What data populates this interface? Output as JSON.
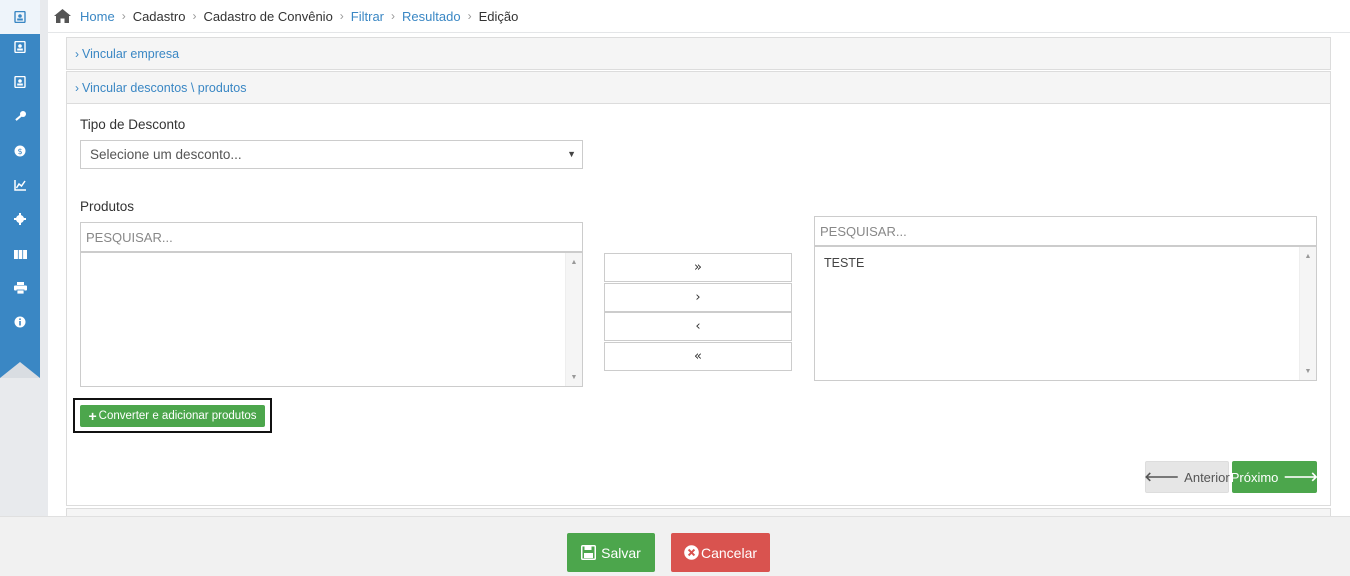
{
  "breadcrumb": {
    "items": [
      {
        "label": "Home",
        "link": true
      },
      {
        "label": "Cadastro",
        "link": false
      },
      {
        "label": "Cadastro de Convênio",
        "link": false
      },
      {
        "label": "Filtrar",
        "link": true
      },
      {
        "label": "Resultado",
        "link": true
      },
      {
        "label": "Edição",
        "link": false
      }
    ]
  },
  "sidebar": {
    "icons": [
      "contact-icon",
      "contact-icon",
      "contact-icon",
      "key-icon",
      "dollar-icon",
      "chart-icon",
      "gear-icon",
      "grid-icon",
      "print-icon",
      "info-icon"
    ]
  },
  "panels": {
    "vincular_empresa": "Vincular empresa",
    "vincular_descontos": "Vincular descontos \\ produtos"
  },
  "form": {
    "tipo_desconto_label": "Tipo de Desconto",
    "tipo_desconto_selected": "Selecione um desconto...",
    "produtos_label": "Produtos",
    "left_search_placeholder": "PESQUISAR...",
    "right_search_placeholder": "PESQUISAR...",
    "right_list_items": [
      "TESTE"
    ],
    "move_all_right": "»",
    "move_right": "›",
    "move_left": "‹",
    "move_all_left": "«",
    "convert_button": "Converter e adicionar produtos"
  },
  "wizard": {
    "prev_label": "Anterior",
    "next_label": "Próximo"
  },
  "footer": {
    "save_label": "Salvar",
    "cancel_label": "Cancelar"
  },
  "colors": {
    "sidebar": "#3a87c4",
    "link": "#3a87c4",
    "success": "#4ca64c",
    "danger": "#d9534f"
  }
}
